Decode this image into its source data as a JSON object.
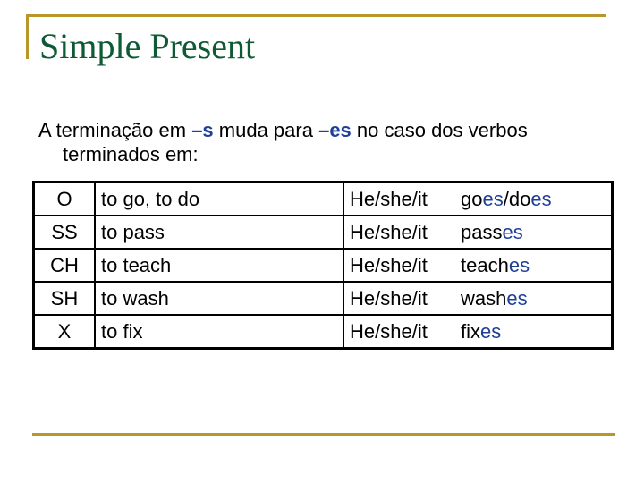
{
  "slide": {
    "title": "Simple Present",
    "accent_color": "#b8962a",
    "title_color": "#0e5a34",
    "highlight_color": "#1f3f99"
  },
  "intro": {
    "part1": "A terminação em ",
    "highlight1": "–s",
    "part2": " muda para ",
    "highlight2": "–es",
    "part3": " no caso dos verbos terminados em:"
  },
  "table": {
    "rows": [
      {
        "ending": "O",
        "base": "to go, to do",
        "subject": "He/she/it",
        "form_parts": [
          {
            "t": "go",
            "hl": false
          },
          {
            "t": "es",
            "hl": true
          },
          {
            "t": "/do",
            "hl": false
          },
          {
            "t": "es",
            "hl": true
          }
        ]
      },
      {
        "ending": "SS",
        "base": "to pass",
        "subject": "He/she/it",
        "form_parts": [
          {
            "t": "pass",
            "hl": false
          },
          {
            "t": "es",
            "hl": true
          }
        ]
      },
      {
        "ending": "CH",
        "base": "to teach",
        "subject": "He/she/it",
        "form_parts": [
          {
            "t": "teach",
            "hl": false
          },
          {
            "t": "es",
            "hl": true
          }
        ]
      },
      {
        "ending": "SH",
        "base": "to wash",
        "subject": "He/she/it",
        "form_parts": [
          {
            "t": "wash",
            "hl": false
          },
          {
            "t": "es",
            "hl": true
          }
        ]
      },
      {
        "ending": "X",
        "base": "to fix",
        "subject": "He/she/it",
        "form_parts": [
          {
            "t": "fix",
            "hl": false
          },
          {
            "t": "es",
            "hl": true
          }
        ]
      }
    ]
  }
}
